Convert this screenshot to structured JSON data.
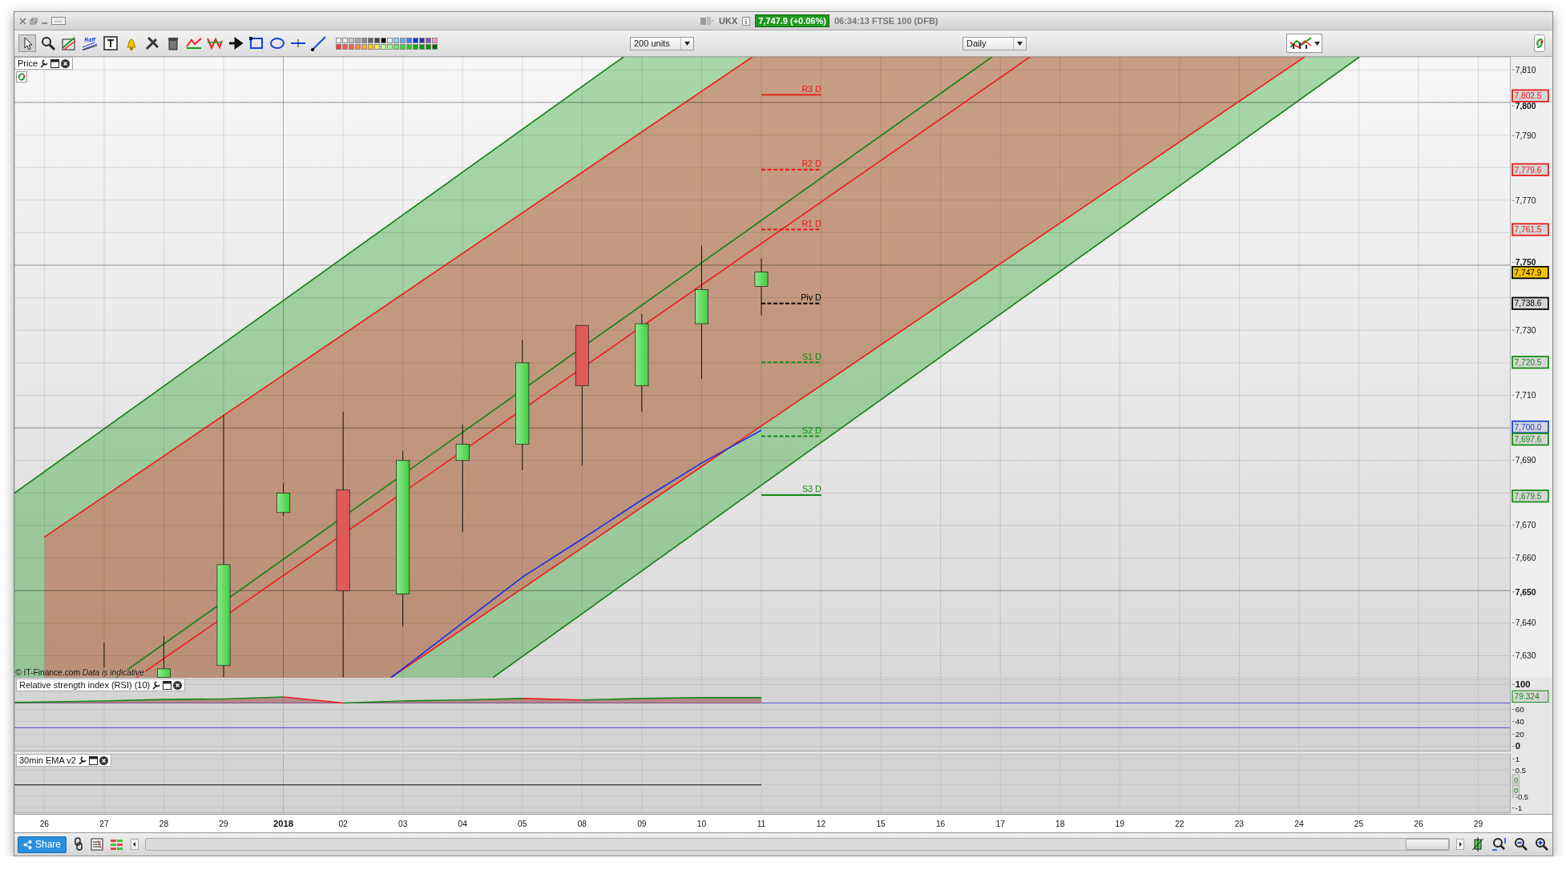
{
  "window": {
    "instrument": "UKX",
    "price_badge": "7,747.9 (+0.06%)",
    "time_and_market": "06:34:13 FTSE 100 (DFB)"
  },
  "toolbar": {
    "raff_label": "Raff",
    "units_select": "200 units",
    "period_select": "Daily"
  },
  "price_panel": {
    "title": "Price",
    "copyright": "© IT-Finance.com",
    "disclaimer": "Data is indicative",
    "pivots": [
      {
        "label": "R3 D",
        "color": "#e81919",
        "dashed": false
      },
      {
        "label": "R2 D",
        "color": "#e81919",
        "dashed": true
      },
      {
        "label": "R1 D",
        "color": "#e81919",
        "dashed": true
      },
      {
        "label": "Piv D",
        "color": "#000000",
        "dashed": true
      },
      {
        "label": "S1 D",
        "color": "#138a13",
        "dashed": true
      },
      {
        "label": "S2 D",
        "color": "#138a13",
        "dashed": true
      },
      {
        "label": "S3 D",
        "color": "#138a13",
        "dashed": false
      }
    ],
    "axis_ticks": [
      {
        "label": "7,810",
        "major": false
      },
      {
        "label": "7,800",
        "major": true
      },
      {
        "label": "7,790",
        "major": false
      },
      {
        "label": "7,770",
        "major": false
      },
      {
        "label": "7,750",
        "major": true
      },
      {
        "label": "7,730",
        "major": false
      },
      {
        "label": "7,710",
        "major": false
      },
      {
        "label": "7,690",
        "major": false
      },
      {
        "label": "7,670",
        "major": false
      },
      {
        "label": "7,660",
        "major": false
      },
      {
        "label": "7,650",
        "major": true
      },
      {
        "label": "7,640",
        "major": false
      },
      {
        "label": "7,630",
        "major": false
      }
    ],
    "price_tags": [
      {
        "label": "7,802.5",
        "color": "#e81919",
        "kind": "level"
      },
      {
        "label": "7,779.6",
        "color": "#e81919",
        "kind": "level"
      },
      {
        "label": "7,761.5",
        "color": "#e81919",
        "kind": "level"
      },
      {
        "label": "7,747.9",
        "color": "#000000",
        "kind": "current"
      },
      {
        "label": "7,738.6",
        "color": "#000000",
        "kind": "level"
      },
      {
        "label": "7,720.5",
        "color": "#138a13",
        "kind": "level"
      },
      {
        "label": "7,700.0",
        "color": "#1a3ee0",
        "kind": "level"
      },
      {
        "label": "7,697.6",
        "color": "#138a13",
        "kind": "level"
      },
      {
        "label": "7,679.5",
        "color": "#138a13",
        "kind": "level"
      }
    ]
  },
  "rsi_panel": {
    "title": "Relative strength index (RSI) (10)",
    "value_tag": "79.324",
    "axis_ticks": [
      {
        "label": "100",
        "major": true
      },
      {
        "label": "60",
        "major": false
      },
      {
        "label": "40",
        "major": false
      },
      {
        "label": "20",
        "major": false
      },
      {
        "label": "0",
        "major": true
      }
    ]
  },
  "ema_panel": {
    "title": "30min EMA v2",
    "value_tags": [
      "0",
      "0"
    ],
    "axis_ticks": [
      {
        "label": "1",
        "major": false
      },
      {
        "label": "0.5",
        "major": false
      },
      {
        "label": "-0.5",
        "major": false
      },
      {
        "label": "-1",
        "major": false
      }
    ]
  },
  "x_axis": [
    {
      "label": "26",
      "major": false
    },
    {
      "label": "27",
      "major": false
    },
    {
      "label": "28",
      "major": false
    },
    {
      "label": "29",
      "major": false
    },
    {
      "label": "2018",
      "major": true
    },
    {
      "label": "02",
      "major": false
    },
    {
      "label": "03",
      "major": false
    },
    {
      "label": "04",
      "major": false
    },
    {
      "label": "05",
      "major": false
    },
    {
      "label": "08",
      "major": false
    },
    {
      "label": "09",
      "major": false
    },
    {
      "label": "10",
      "major": false
    },
    {
      "label": "11",
      "major": false
    },
    {
      "label": "12",
      "major": false
    },
    {
      "label": "15",
      "major": false
    },
    {
      "label": "16",
      "major": false
    },
    {
      "label": "17",
      "major": false
    },
    {
      "label": "18",
      "major": false
    },
    {
      "label": "19",
      "major": false
    },
    {
      "label": "22",
      "major": false
    },
    {
      "label": "23",
      "major": false
    },
    {
      "label": "24",
      "major": false
    },
    {
      "label": "25",
      "major": false
    },
    {
      "label": "26",
      "major": false
    },
    {
      "label": "29",
      "major": false
    }
  ],
  "bottom_bar": {
    "share_button": "Share"
  }
}
